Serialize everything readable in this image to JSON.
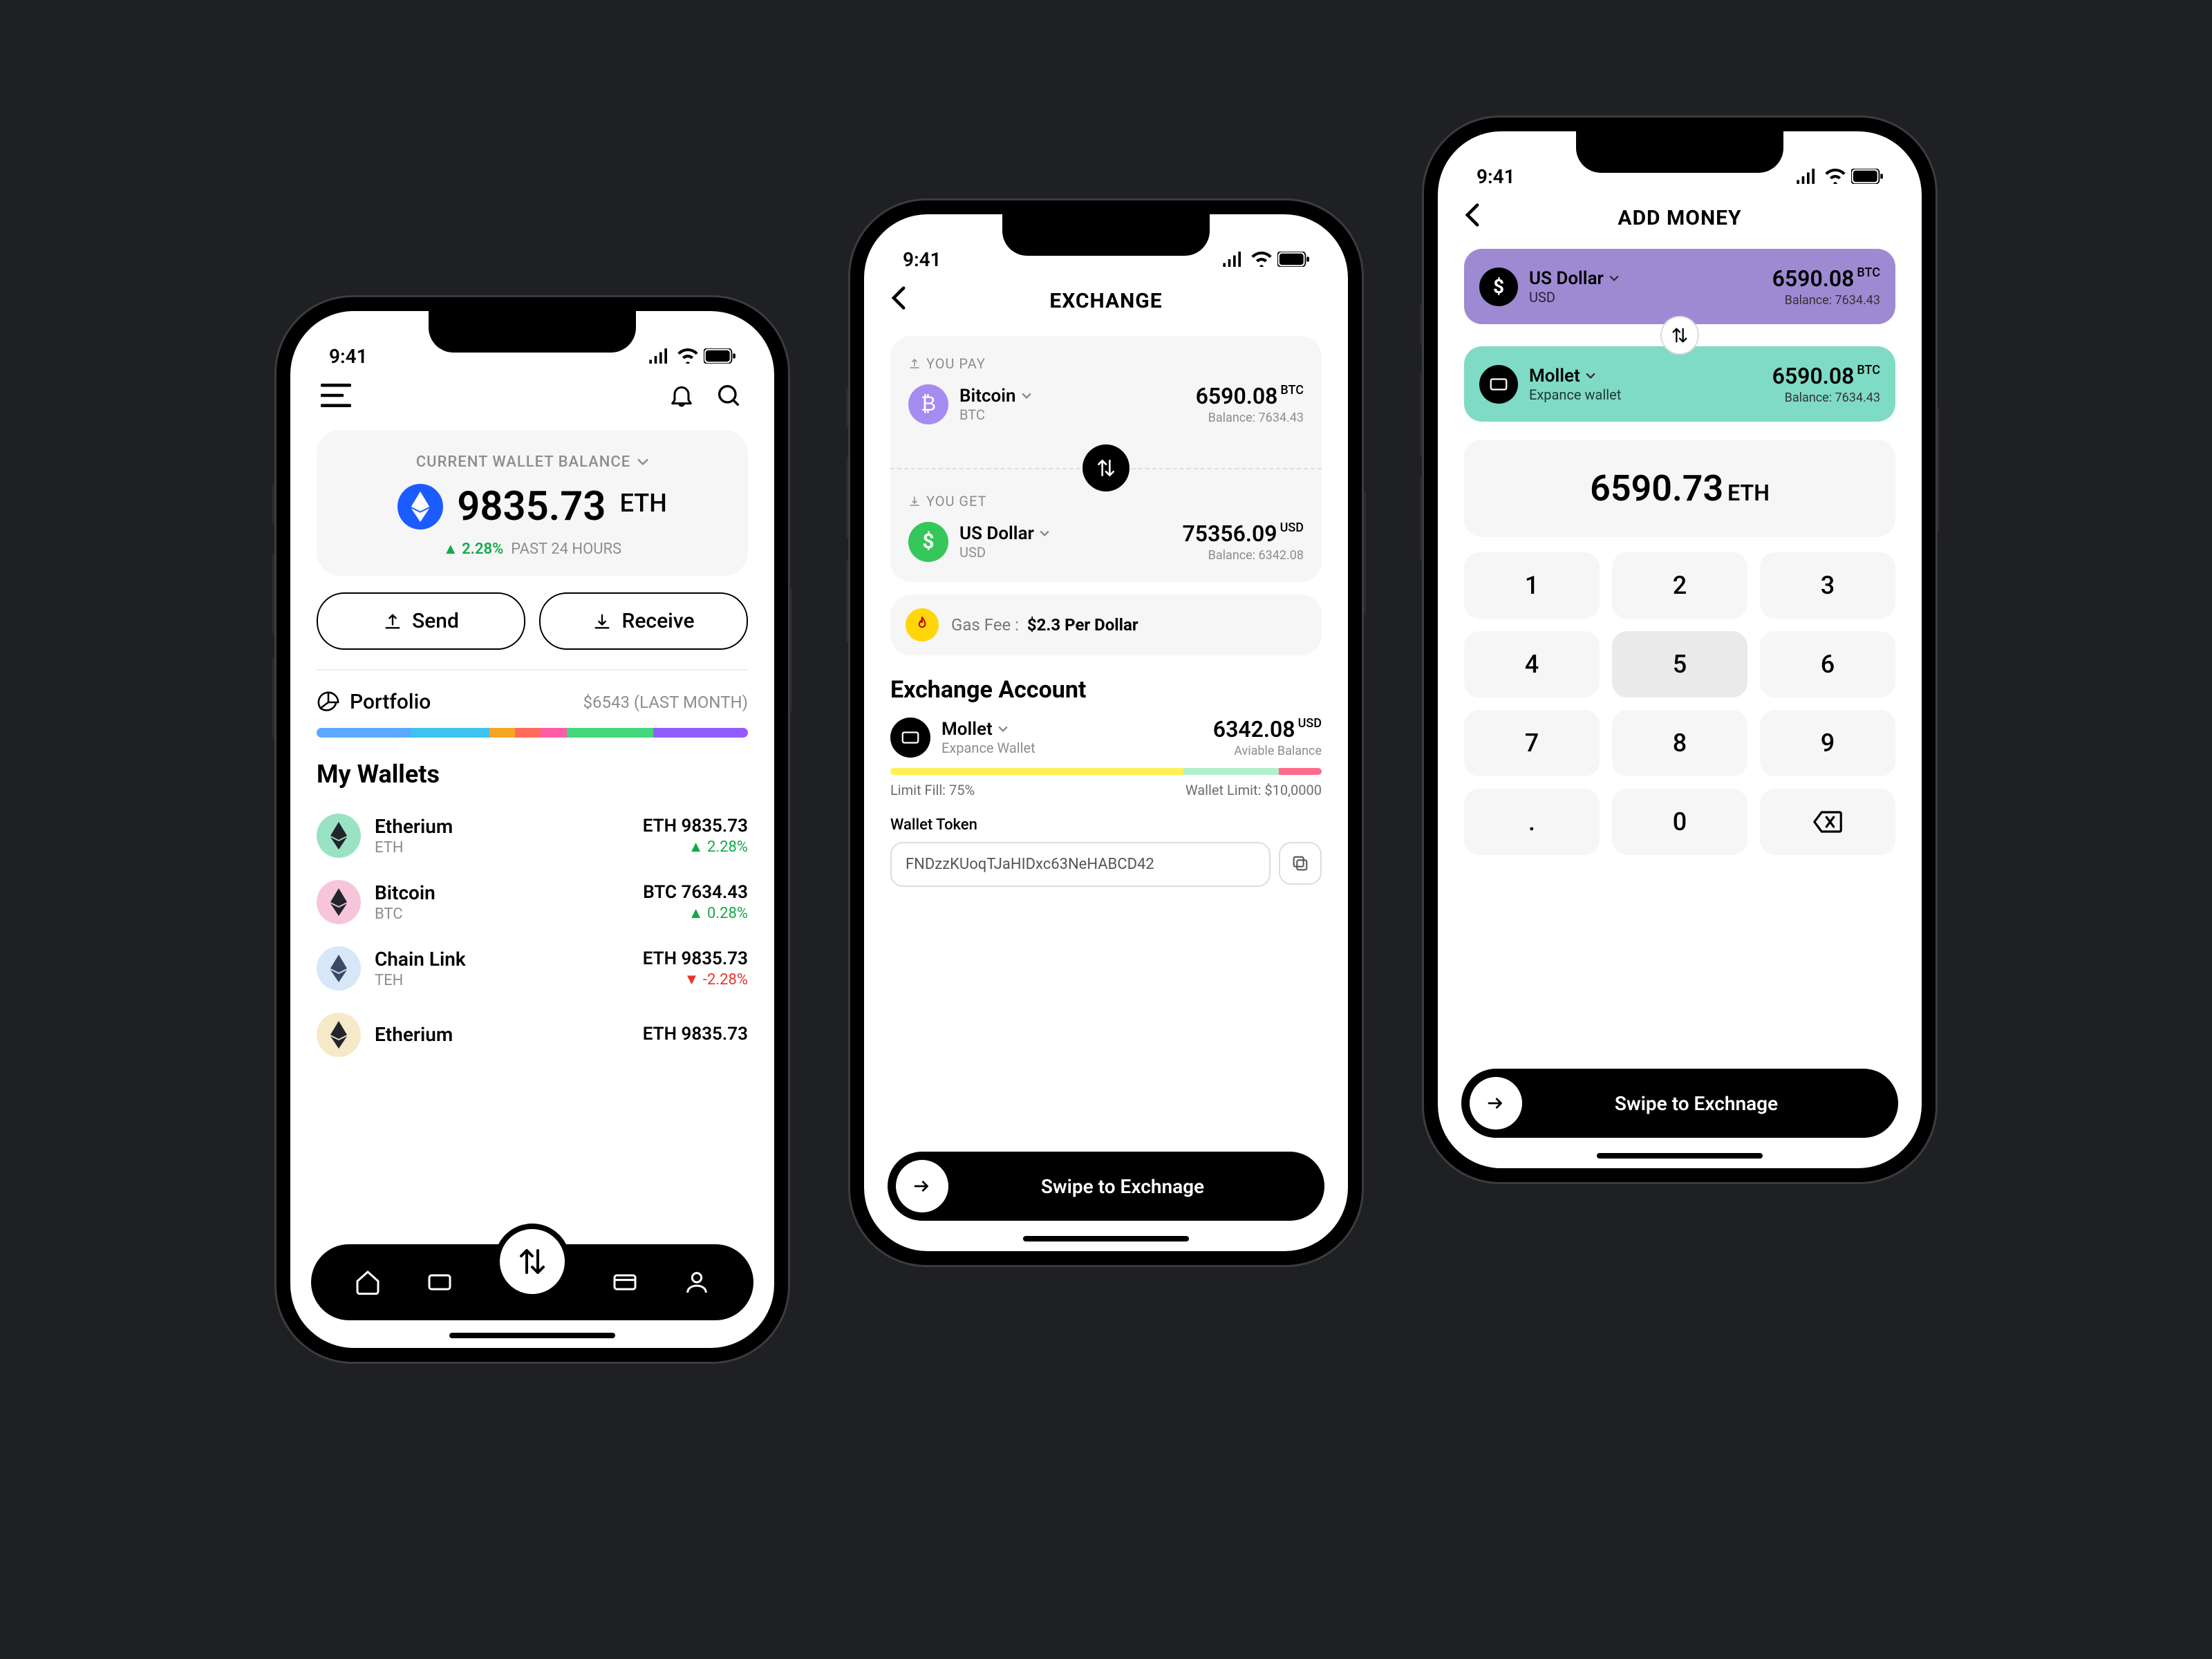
{
  "status": {
    "time": "9:41"
  },
  "screen1": {
    "balance_label": "CURRENT WALLET BALANCE",
    "balance_amount": "9835.73",
    "balance_unit": "ETH",
    "change_pct": "2.28%",
    "change_label": "PAST 24 HOURS",
    "send_label": "Send",
    "receive_label": "Receive",
    "portfolio_label": "Portfolio",
    "portfolio_sub": "$6543 (LAST MONTH)",
    "portfolio_segments": [
      {
        "w": 22,
        "c": "#5aa9ff"
      },
      {
        "w": 18,
        "c": "#3cc3f0"
      },
      {
        "w": 6,
        "c": "#f5a623"
      },
      {
        "w": 6,
        "c": "#ff6b5b"
      },
      {
        "w": 6,
        "c": "#ff5ca8"
      },
      {
        "w": 20,
        "c": "#43d67a"
      },
      {
        "w": 22,
        "c": "#935cff"
      }
    ],
    "mywallets_title": "My Wallets",
    "wallets": [
      {
        "name": "Etherium",
        "sym": "ETH",
        "amt": "ETH 9835.73",
        "chg": "2.28%",
        "dir": "up",
        "bg": "#9ae2c4",
        "dark": "#22252b"
      },
      {
        "name": "Bitcoin",
        "sym": "BTC",
        "amt": "BTC 7634.43",
        "chg": "0.28%",
        "dir": "up",
        "bg": "#f7c5da",
        "dark": "#22252b"
      },
      {
        "name": "Chain Link",
        "sym": "TEH",
        "amt": "ETH 9835.73",
        "chg": "-2.28%",
        "dir": "down",
        "bg": "#d7e6f9",
        "dark": "#3a4a66"
      },
      {
        "name": "Etherium",
        "sym": "",
        "amt": "ETH 9835.73",
        "chg": "",
        "dir": "up",
        "bg": "#f5e9c7",
        "dark": "#22252b"
      }
    ]
  },
  "screen2": {
    "title": "EXCHANGE",
    "pay_label": "YOU PAY",
    "pay": {
      "name": "Bitcoin",
      "sym": "BTC",
      "amt": "6590.08",
      "unit": "BTC",
      "bal": "Balance: 7634.43",
      "bg": "#a58cf0",
      "glyph": "₿"
    },
    "get_label": "YOU GET",
    "get": {
      "name": "US Dollar",
      "sym": "USD",
      "amt": "75356.09",
      "unit": "USD",
      "bal": "Balance: 6342.08",
      "bg": "#35c759",
      "glyph": "$"
    },
    "gas_label": "Gas Fee :",
    "gas_value": "$2.3 Per Dollar",
    "ex_acc_title": "Exchange Account",
    "acc": {
      "name": "Mollet",
      "sub": "Expance Wallet",
      "amt": "6342.08",
      "unit": "USD",
      "bal_label": "Aviable Balance"
    },
    "limit_fill_label": "Limit Fill: 75%",
    "wallet_limit_label": "Wallet Limit: $10,0000",
    "limit_segments": [
      {
        "w": 68,
        "c": "#fff154"
      },
      {
        "w": 22,
        "c": "#b1efc9"
      },
      {
        "w": 10,
        "c": "#ff6b8a"
      }
    ],
    "wallet_token_label": "Wallet Token",
    "wallet_token_value": "FNDzzKUoqTJaHIDxc63NeHABCD42",
    "swipe_label": "Swipe to Exchnage"
  },
  "screen3": {
    "title": "ADD MONEY",
    "from": {
      "name": "US Dollar",
      "sym": "USD",
      "amt": "6590.08",
      "unit": "BTC",
      "bal": "Balance: 7634.43"
    },
    "to": {
      "name": "Mollet",
      "sym": "Expance wallet",
      "amt": "6590.08",
      "unit": "BTC",
      "bal": "Balance: 7634.43"
    },
    "big_amount": "6590.73",
    "big_unit": "ETH",
    "keys": [
      "1",
      "2",
      "3",
      "4",
      "5",
      "6",
      "7",
      "8",
      "9",
      ".",
      "0",
      "⌫"
    ],
    "swipe_label": "Swipe to Exchnage"
  }
}
